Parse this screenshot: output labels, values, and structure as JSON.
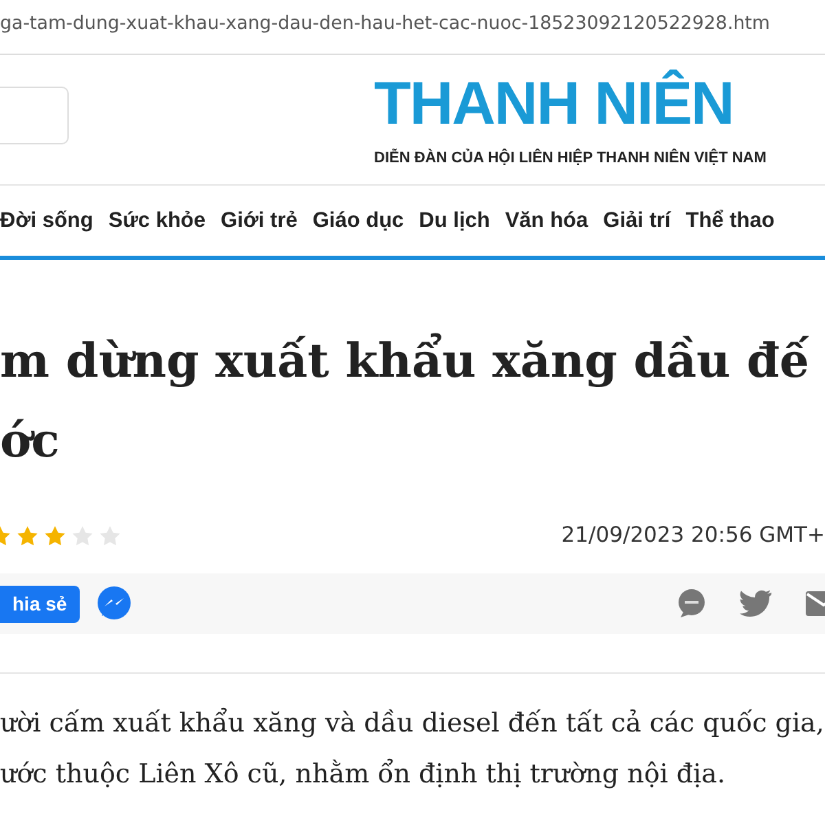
{
  "address_bar": {
    "url": "ga-tam-dung-xuat-khau-xang-dau-den-hau-het-cac-nuoc-18523092120522928.htm"
  },
  "header": {
    "logo": "THANH NIÊN",
    "tagline": "DIỄN ĐÀN CỦA HỘI LIÊN HIỆP THANH NIÊN VIỆT NAM"
  },
  "nav": [
    "Đời sống",
    "Sức khỏe",
    "Giới trẻ",
    "Giáo dục",
    "Du lịch",
    "Văn hóa",
    "Giải trí",
    "Thể thao"
  ],
  "article": {
    "title_lines": [
      "m dừng xuất khẩu xăng dầu đế",
      "ớc"
    ],
    "stars": 3,
    "date": "21/09/2023 20:56 GMT+",
    "share_button": "hia sẻ",
    "body_lines": [
      "ười cấm xuất khẩu xăng và dầu diesel đến tất cả các quốc gia,",
      "ước thuộc Liên Xô cũ, nhằm ổn định thị trường nội địa."
    ]
  }
}
